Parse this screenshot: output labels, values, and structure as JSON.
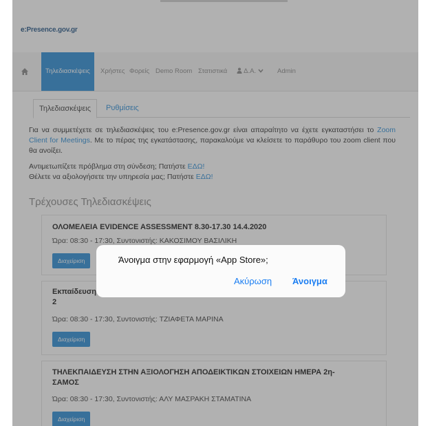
{
  "header": {
    "logo_prefix": "e:",
    "logo_text": "Presence.gov.gr"
  },
  "nav": {
    "home_icon": "home-icon",
    "items": [
      {
        "label": "Τηλεδιασκέψεις"
      },
      {
        "label": "Χρήστες"
      },
      {
        "label": "Φορείς"
      },
      {
        "label": "Demo Room"
      },
      {
        "label": "Στατιστικά"
      },
      {
        "label": "Δ.Α."
      },
      {
        "label": "Admin"
      }
    ]
  },
  "tabs": {
    "active": "Τηλεδιασκέψεις",
    "settings": "Ρυθμίσεις"
  },
  "intro": {
    "p1_a": "Για να συμμετέχετε σε τηλεδιασκέψεις του e:Presence.gov.gr είναι απαραίτητο να έχετε εγκαταστήσει το ",
    "p1_link": "Zoom Client for Meetings",
    "p1_b": ". Με το πέρας της εγκατάστασης, παρακαλούμε να κλείσετε το παράθυρο του zoom client που θα ανοίξει.",
    "p2_a": "Αντιμετωπίζετε πρόβλημα στη σύνδεση; Πατήστε ",
    "p2_link": "ΕΔΩ!",
    "p3_a": "Θέλετε να αξιολογήσετε την υπηρεσία μας; Πατήστε ",
    "p3_link": "ΕΔΩ!"
  },
  "section_title": "Τρέχουσες Τηλεδιασκέψεις",
  "meetings": [
    {
      "title": "ΟΛΟΜΕΛΕΙΑ EVIDENCE ASSESSMENT 8.30-17.30 14.4.2020",
      "meta": "Ώρα: 08:30 - 17:30, Συντονιστής: ΚΑΚΟΣΙΜΟΥ ΒΑΣΙΛΙΚΗ",
      "button": "Διαχείριση"
    },
    {
      "title_line1": "Εκπαίδευση στην Αξιολόγηση Αποδεικτικών Στοιχείων Εφαρμογή GROUP 3_DAY",
      "title_line2": "2",
      "meta": "Ώρα: 08:30 - 17:30, Συντονιστής: ΤΖΙΑΦΕΤΑ ΜΑΡΙΝΑ",
      "button": "Διαχείριση"
    },
    {
      "title_line1": "ΤΗΛΕΚΠΑΙΔΕΥΣΗ ΣΤΗΝ ΑΞΙΟΛΟΓΗΣΗ ΑΠΟΔΕΙΚΤΙΚΩΝ ΣΤΟΙΧΕΙΩΝ ΗΜΕΡΑ 2η-",
      "title_line2": "ΣΑΜΟΣ",
      "meta": "Ώρα: 08:30 - 17:30, Συντονιστής: ΑΛΥ ΜΑΣΡΑΚΗ ΣΤΑΜΑΤΙΝΑ",
      "button": "Διαχείριση"
    }
  ],
  "dialog": {
    "message": "Άνοιγμα στην εφαρμογή «App Store»;",
    "cancel": "Ακύρωση",
    "open": "Άνοιγμα"
  },
  "colors": {
    "accent": "#2f8fd8",
    "ios_blue": "#1b7ef2"
  }
}
